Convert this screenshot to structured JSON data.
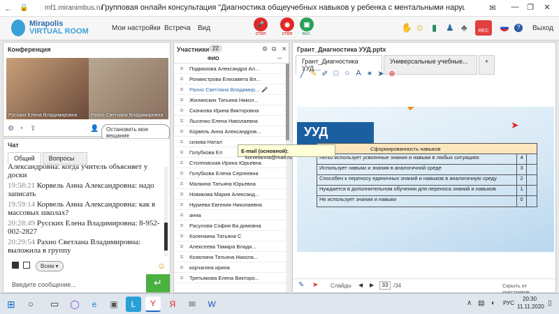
{
  "browser": {
    "url": "mf1.miranimbus.ru",
    "title": "Групповая онлайн консультация \"Диагностика общеучебных навыков у ребенка с ментальными нарушениям..."
  },
  "header": {
    "logo": "Mirapolis",
    "logo_sub": "VIRTUAL ROOM",
    "menu": [
      "Мои настройки",
      "Встреча",
      "Вид"
    ],
    "controls": [
      {
        "label": "стоп",
        "color": "#e02828"
      },
      {
        "label": "стоп",
        "color": "#e02828"
      },
      {
        "label": "вкл.",
        "color": "#2aa05a"
      }
    ],
    "rec": "REC",
    "exit": "Выход"
  },
  "conference": {
    "title": "Конференция",
    "participants": [
      "Русских Елена Владимировна",
      "Рахно Светлана Владимировна"
    ],
    "stop_button": "Остановить мое вещание"
  },
  "chat": {
    "title": "Чат",
    "tabs": [
      "Общий",
      "Вопросы"
    ],
    "messages": [
      {
        "time": "",
        "text": "Александровна: когда учитель объясняет у доски"
      },
      {
        "time": "19:58:21",
        "text": "Корвель Анна Александровна: надо записать"
      },
      {
        "time": "19:59:14",
        "text": "Корвель Анна Александровна: как в массовых школах?"
      },
      {
        "time": "20:28:49",
        "text": "Русских Елена Владимировна: 8-952-002-2827"
      },
      {
        "time": "20:29:54",
        "text": "Рахно Светлана Владимировна: выложила в группу"
      }
    ],
    "recipient": "Всем",
    "input_placeholder": "Введите сообщение..."
  },
  "participants": {
    "title": "Участники",
    "count": "22",
    "col_header": "ФИО",
    "col_extra": "...",
    "list": [
      "Подмазова Александра Ал...",
      "Рохмистрова Елизавета Вл...",
      "Рахно Светлана Владимир...",
      "Жилинских Татьяна Никол...",
      "Скачкова Ирина Викторовна",
      "Лысенко Елена Николаевна",
      "Корвель Анна Александров...",
      "сизова Натал",
      "Голубкова Ел",
      "Столповская Ирина Юрьевна",
      "Голубкова Елена Сергеевна",
      "Малкина Татьяна Юрьевна",
      "Новикова Мария Александ...",
      "Нуриева Евгения Николаевна",
      "анна",
      "Расулова София Ва димовна",
      "Коленкина Татьяна С",
      "Алексеева Тамара Влади...",
      "Козюлина Татьяна Никола...",
      "корчагина ирина",
      "Третьякова Елена Викторо..."
    ],
    "tooltip_label": "E-mail (основной):",
    "tooltip_value": "korvelanna@mail.ru"
  },
  "presentation": {
    "title": "Грант_Диагностика УУД.pptx",
    "tabs": [
      "Грант_Диагностика УУД....",
      "Универсальные учебные...",
      "+"
    ],
    "slide_title": "УУД",
    "slide_header": "Сформированность навыков",
    "rows": [
      {
        "text": "Легко использует усвоенные знания и навыки в любых ситуациях",
        "value": "4"
      },
      {
        "text": "Использует навыки и знания в аналогичной среде",
        "value": "3"
      },
      {
        "text": "Способен к переносу единичных знаний и навыков в аналогичную среду",
        "value": "2"
      },
      {
        "text": "Нуждается в дополнительном обучении для переноса знаний и навыков",
        "value": "1"
      },
      {
        "text": "Не использует знания и навыки",
        "value": "0"
      }
    ],
    "slides_label": "Слайды",
    "current": "33",
    "total": "/34",
    "hide_label": "Скрыть от участников"
  },
  "taskbar": {
    "lang": "РУС",
    "time": "20:30",
    "date": "11.11.2020"
  }
}
